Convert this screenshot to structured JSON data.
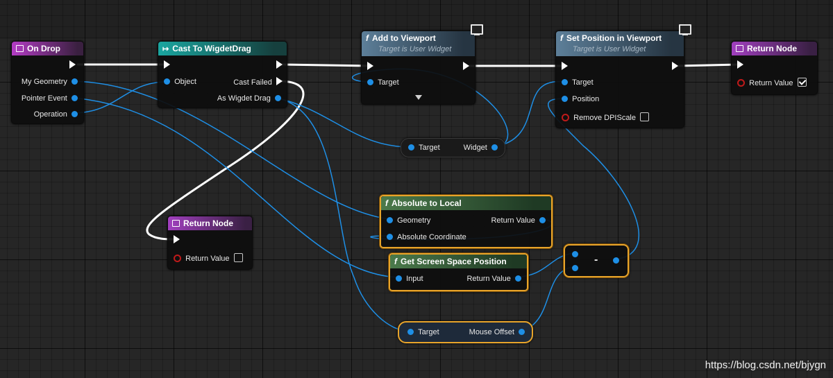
{
  "nodes": {
    "on_drop": {
      "title": "On Drop",
      "pins": {
        "my_geometry": "My Geometry",
        "pointer_event": "Pointer Event",
        "operation": "Operation"
      }
    },
    "cast": {
      "title": "Cast To WigdetDrag",
      "pins": {
        "object": "Object",
        "cast_failed": "Cast Failed",
        "as_widget_drag": "As Wigdet Drag"
      }
    },
    "add_to_viewport": {
      "title": "Add to Viewport",
      "subtitle": "Target is User Widget",
      "pins": {
        "target": "Target"
      }
    },
    "set_position": {
      "title": "Set Position in Viewport",
      "subtitle": "Target is User Widget",
      "pins": {
        "target": "Target",
        "position": "Position",
        "remove_dpi": "Remove DPIScale"
      }
    },
    "return_top": {
      "title": "Return Node",
      "pins": {
        "return_value": "Return Value"
      },
      "return_checked": true
    },
    "get_widget": {
      "pins": {
        "target": "Target",
        "widget": "Widget"
      }
    },
    "absolute_to_local": {
      "title": "Absolute to Local",
      "pins": {
        "geometry": "Geometry",
        "absolute_coordinate": "Absolute Coordinate",
        "return_value": "Return Value"
      }
    },
    "return_mid": {
      "title": "Return Node",
      "pins": {
        "return_value": "Return Value"
      },
      "return_checked": false
    },
    "get_screen_space": {
      "title": "Get Screen Space Position",
      "pins": {
        "input": "Input",
        "return_value": "Return Value"
      }
    },
    "subtract": {
      "symbol": "-"
    },
    "mouse_offset": {
      "pins": {
        "target": "Target",
        "mouse_offset": "Mouse Offset"
      }
    }
  },
  "icons": {
    "function": "function-f-icon",
    "event": "event-box-icon",
    "cast": "cast-arrow-icon",
    "monitor": "monitor-icon"
  },
  "colors": {
    "exec": "#ffffff",
    "struct_pin": "#1e8fe6",
    "bool_pin": "#c01a1a",
    "selection": "#e8a42a"
  },
  "watermark": "https://blog.csdn.net/bjygn"
}
